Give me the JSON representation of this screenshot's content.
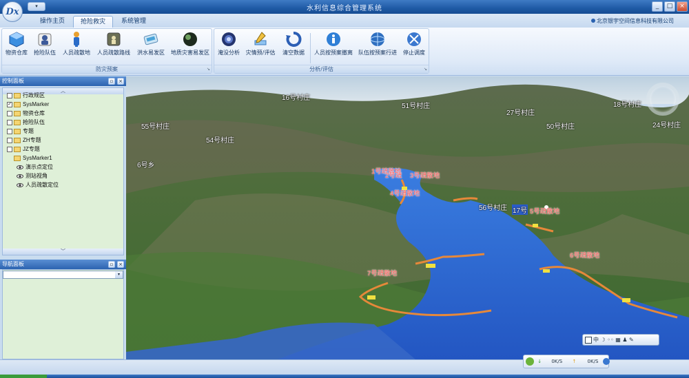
{
  "app": {
    "title": "水利信息综合管理系统",
    "logo_text": "Dx",
    "quick_access": "▾",
    "company": "北京银宇空间信息科技有限公司"
  },
  "window_buttons": {
    "minimize": "_",
    "maximize": "□",
    "close": "×"
  },
  "tabs": [
    "操作主页",
    "抢险救灾",
    "系统管理"
  ],
  "ribbon": {
    "groups": [
      {
        "label": "防灾预案",
        "buttons": [
          "物资仓库",
          "抢险队伍",
          "人员疏散地",
          "人员疏散路线",
          "洪水易发区",
          "地质灾害易发区"
        ]
      },
      {
        "label": "分析/评估",
        "buttons": [
          "淹没分析",
          "灾情预/评估",
          "清空数据",
          "人员按预案撤离",
          "队伍按预案行进",
          "停止调度"
        ]
      }
    ],
    "launcher": "↘"
  },
  "control_panel": {
    "title": "控制面板",
    "pin": "▫",
    "close": "×",
    "scroll_up": "︿",
    "scroll_down": "﹀",
    "tree": [
      {
        "label": "行政规区",
        "check": "",
        "type": "folder"
      },
      {
        "label": "SysMarker",
        "check": "✓",
        "type": "folder"
      },
      {
        "label": "物资仓库",
        "check": "",
        "type": "folder"
      },
      {
        "label": "抢险队伍",
        "check": "",
        "type": "folder"
      },
      {
        "label": "专题",
        "check": "",
        "type": "folder"
      },
      {
        "label": "ZH专题",
        "check": "",
        "type": "folder"
      },
      {
        "label": "JZ专题",
        "check": "",
        "type": "folder"
      },
      {
        "label": "SysMarker1",
        "check": "",
        "type": "folder"
      },
      {
        "label": "演示点定位",
        "type": "eye"
      },
      {
        "label": "测站视角",
        "type": "eye"
      },
      {
        "label": "人员疏散定位",
        "type": "eye"
      }
    ]
  },
  "nav_panel": {
    "title": "导航面板",
    "pin": "▫",
    "close": "×",
    "combo_arrow": "▾"
  },
  "map": {
    "village_labels": [
      "16号村庄",
      "51号村庄",
      "55号村庄",
      "27号村庄",
      "18号村庄",
      "50号村庄",
      "24号村庄",
      "54号村庄",
      "6号乡",
      "56号村庄"
    ],
    "evac_labels": [
      "1号疏散地",
      "2号疏",
      "3号疏散地",
      "4号疏散地",
      "5号疏散地",
      "6号疏散地",
      "7号疏散地"
    ],
    "marker_17": "17号"
  },
  "map_toolbar": {
    "text": "中 ☽ ◦◦ ▦ ♟ ✎"
  },
  "net_status": {
    "down": "0K/S",
    "up": "0K/S"
  },
  "colors": {
    "water": "#2a6fd8",
    "route": "#e6883a",
    "accent": "#2c63b0"
  }
}
